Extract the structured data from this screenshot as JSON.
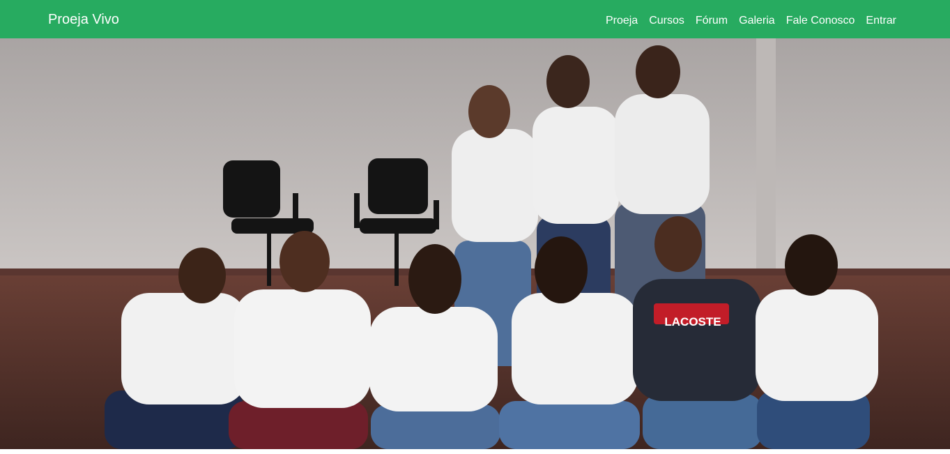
{
  "navbar": {
    "brand": "Proeja Vivo",
    "links": [
      "Proeja",
      "Cursos",
      "Fórum",
      "Galeria",
      "Fale Conosco",
      "Entrar"
    ],
    "color": "#27ab60"
  },
  "hero": {
    "image_icon": "group-photo-image",
    "shirt_text": "LACOSTE"
  }
}
